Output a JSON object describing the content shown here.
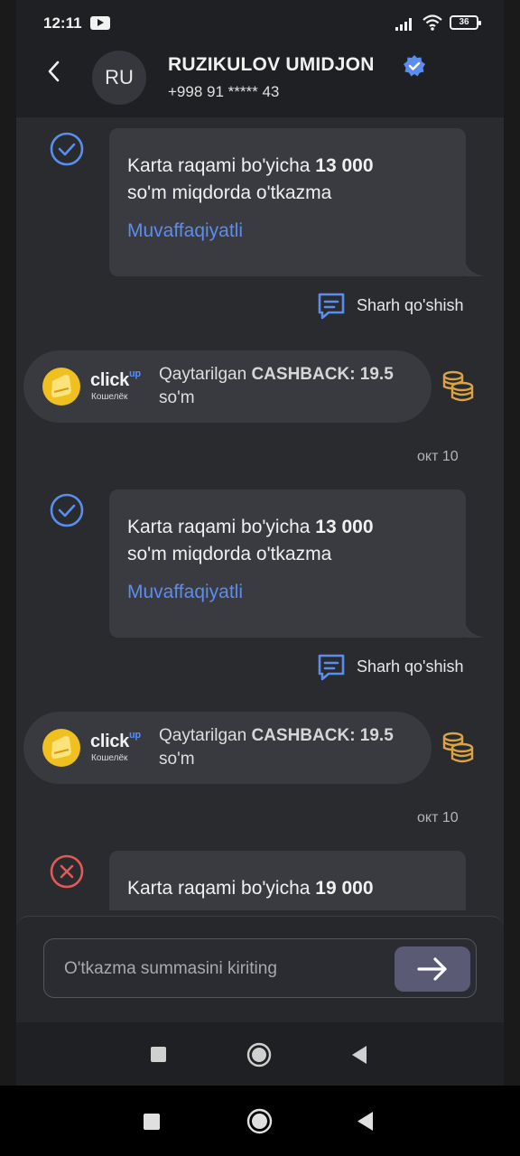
{
  "status_bar": {
    "time": "12:11",
    "battery": "36"
  },
  "contact": {
    "initials": "RU",
    "name": "RUZIKULOV UMIDJON",
    "phone": "+998 91 ***** 43"
  },
  "messages": [
    {
      "prefix": "Karta raqami bo'yicha ",
      "amount": "13 000",
      "line2": "so'm miqdorda o'tkazma",
      "status": "Muvaffaqiyatli",
      "status_type": "success",
      "comment_label": "Sharh qo'shish"
    },
    {
      "brand": "click",
      "brand_sup": "up",
      "brand_sub": "Кошелёк",
      "text_prefix": "Qaytarilgan ",
      "text_bold": "CASHBACK",
      "text_amount": ": 19.5",
      "text_line2": "so'm",
      "date": "окт 10"
    },
    {
      "prefix": "Karta raqami bo'yicha ",
      "amount": "13 000",
      "line2": "so'm miqdorda o'tkazma",
      "status": "Muvaffaqiyatli",
      "status_type": "success",
      "comment_label": "Sharh qo'shish"
    },
    {
      "brand": "click",
      "brand_sup": "up",
      "brand_sub": "Кошелёк",
      "text_prefix": "Qaytarilgan ",
      "text_bold": "CASHBACK",
      "text_amount": ": 19.5",
      "text_line2": "so'm",
      "date": "окт 10"
    },
    {
      "prefix": "Karta raqami bo'yicha ",
      "amount": "19 000",
      "status_type": "failed"
    }
  ],
  "composer": {
    "placeholder": "O'tkazma summasini kiriting"
  },
  "colors": {
    "accent": "#5b8def",
    "error": "#e05a5a",
    "coin": "#d9a441",
    "send_button": "#5a5a75"
  },
  "icons": {
    "back": "chevron-left",
    "verified": "verified-badge",
    "comment": "comment-icon",
    "coins": "coins-icon",
    "send": "arrow-right"
  }
}
